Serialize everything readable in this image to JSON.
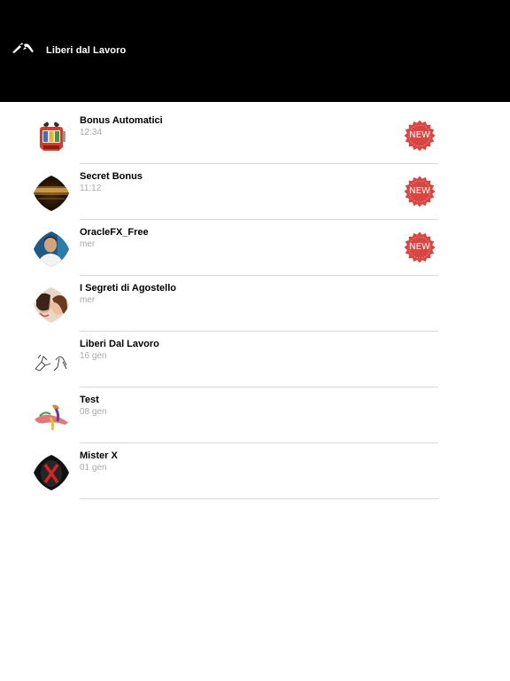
{
  "header": {
    "title": "Liberi dal Lavoro",
    "logo_icon": "quill-logo-icon",
    "background": "#000000"
  },
  "badge_label": "NEW",
  "badge_color": "#d94540",
  "chats": [
    {
      "name": "Bonus Automatici",
      "time": "12:34",
      "is_new": true,
      "avatar_icon": "slot-machine-avatar"
    },
    {
      "name": "Secret Bonus",
      "time": "11:12",
      "is_new": true,
      "avatar_icon": "gold-text-avatar"
    },
    {
      "name": "OracleFX_Free",
      "time": "mer",
      "is_new": true,
      "avatar_icon": "man-portrait-avatar"
    },
    {
      "name": "I Segreti di Agostello",
      "time": "mer",
      "is_new": false,
      "avatar_icon": "whisper-portrait-avatar"
    },
    {
      "name": "Liberi Dal Lavoro",
      "time": "16 gen",
      "is_new": false,
      "avatar_icon": "sketch-avatar"
    },
    {
      "name": "Test",
      "time": "08 gen",
      "is_new": false,
      "avatar_icon": "colorful-figure-avatar"
    },
    {
      "name": "Mister X",
      "time": "01 gen",
      "is_new": false,
      "avatar_icon": "red-x-avatar"
    }
  ]
}
